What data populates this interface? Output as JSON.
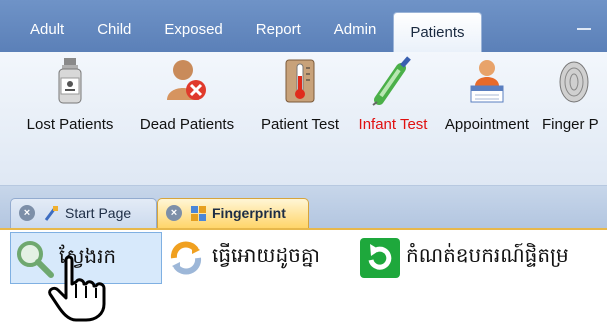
{
  "menu_tabs": [
    {
      "label": "Adult"
    },
    {
      "label": "Child"
    },
    {
      "label": "Exposed"
    },
    {
      "label": "Report"
    },
    {
      "label": "Admin"
    },
    {
      "label": "Patients",
      "active": true
    }
  ],
  "ribbon": {
    "buttons": [
      {
        "label": "Lost Patients",
        "icon": "medicine-bottle-icon"
      },
      {
        "label": "Dead Patients",
        "icon": "person-remove-icon"
      },
      {
        "label": "Patient Test",
        "icon": "thermometer-icon"
      },
      {
        "label": "Infant Test",
        "icon": "syringe-icon",
        "color": "#e01010"
      },
      {
        "label": "Appointment",
        "icon": "calendar-person-icon"
      },
      {
        "label": "Finger P",
        "icon": "fingerprint-icon"
      }
    ]
  },
  "doc_tabs": [
    {
      "label": "Start Page",
      "icon": "start-page-icon"
    },
    {
      "label": "Fingerprint",
      "icon": "fingerprint-tab-icon",
      "active": true
    }
  ],
  "toolbar": {
    "buttons": [
      {
        "label": "ស្វែងរក",
        "icon": "search-icon"
      },
      {
        "label": "ធ្វើអោយដូចគ្នា",
        "icon": "refresh-icon"
      },
      {
        "label": "កំណត់ឧបករណ៍ផ្ទិតម្រ",
        "icon": "reload-green-icon"
      }
    ]
  },
  "colors": {
    "menu_bar": "#5b80b8",
    "active_doc_tab": "#ffd56a",
    "infant_test_label": "#e01010"
  }
}
